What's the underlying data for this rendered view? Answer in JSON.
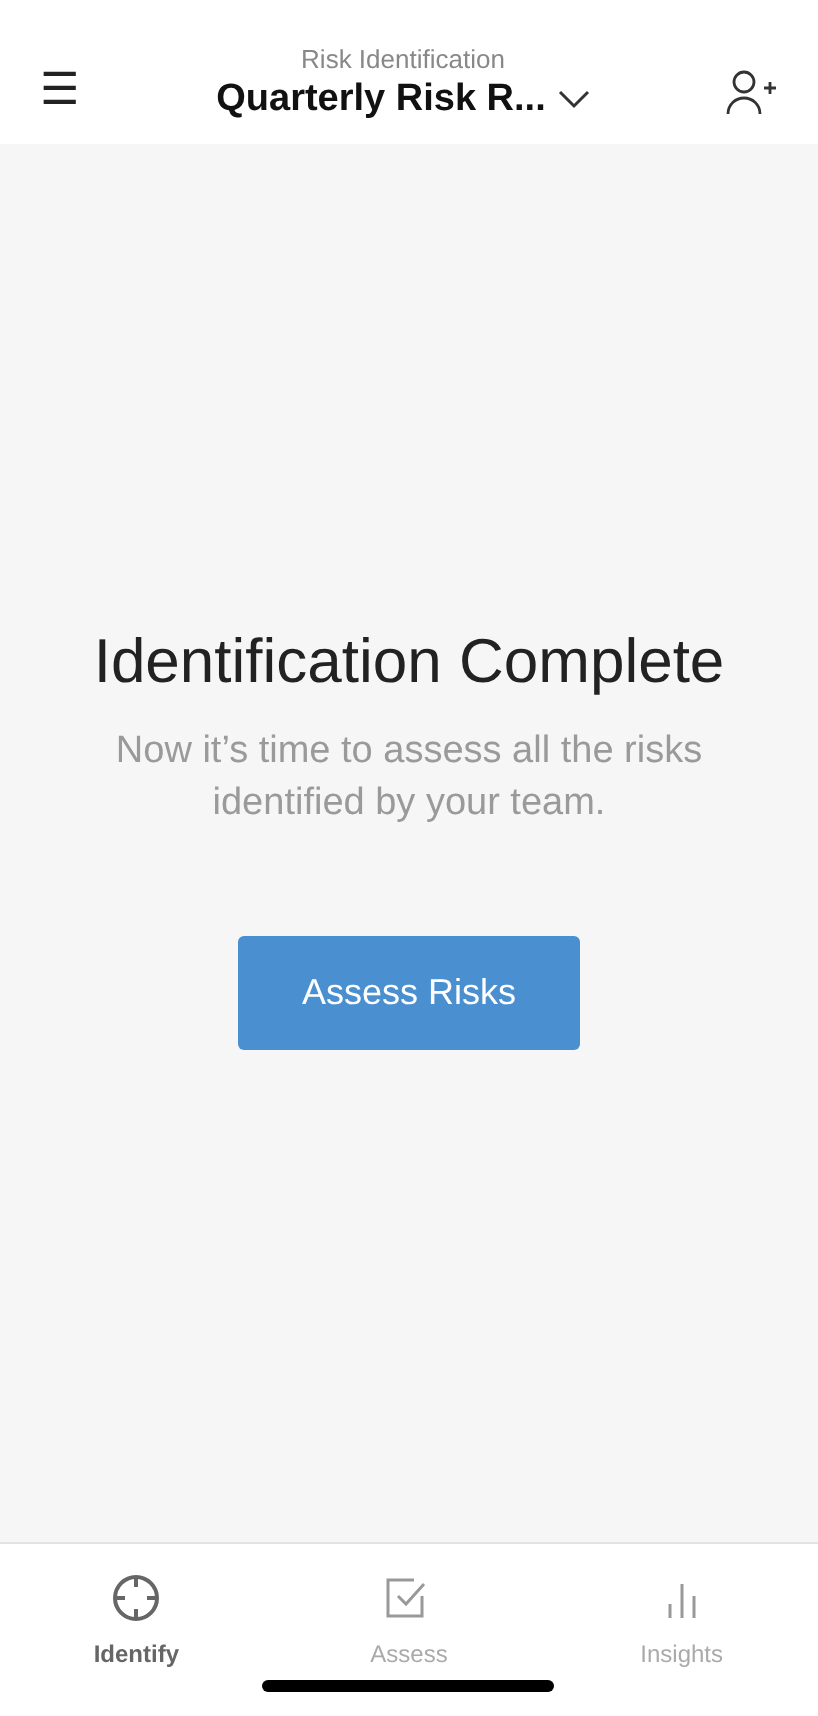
{
  "header": {
    "subtitle": "Risk Identification",
    "title": "Quarterly Risk R...",
    "menu_glyph": "☰"
  },
  "message": {
    "heading": "Identification Complete",
    "body": "Now it’s time to assess all the risks identified by your team.",
    "button": "Assess Risks"
  },
  "tabs": [
    {
      "label": "Identify",
      "kind": "target",
      "selected": true
    },
    {
      "label": "Assess",
      "kind": "check",
      "selected": false
    },
    {
      "label": "Insights",
      "kind": "bars",
      "selected": false
    }
  ]
}
